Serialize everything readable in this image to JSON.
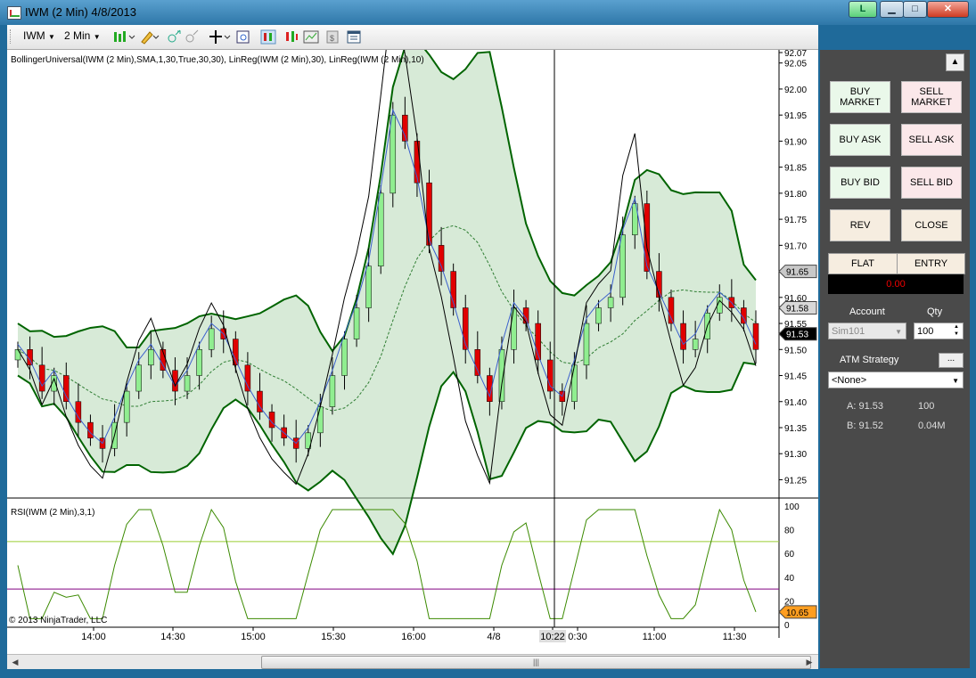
{
  "window": {
    "title": "IWM (2 Min)  4/8/2013",
    "btn_l": "L"
  },
  "toolbar": {
    "instrument": "IWM",
    "interval": "2 Min"
  },
  "chart": {
    "indicator_label": "BollingerUniversal(IWM (2 Min),SMA,1,30,True,30,30), LinReg(IWM (2 Min),30), LinReg(IWM (2 Min),10)",
    "rsi_label": "RSI(IWM (2 Min),3,1)",
    "copyright": "© 2013 NinjaTrader, LLC",
    "price_ticks": [
      "92.07",
      "92.05",
      "92.00",
      "91.95",
      "91.90",
      "91.85",
      "91.80",
      "91.75",
      "91.70",
      "91.65",
      "91.60",
      "91.55",
      "91.50",
      "91.45",
      "91.40",
      "91.35",
      "91.30",
      "91.25"
    ],
    "rsi_ticks": [
      "100",
      "80",
      "60",
      "40",
      "20",
      "0"
    ],
    "time_ticks": [
      "14:00",
      "14:30",
      "15:00",
      "15:30",
      "16:00",
      "4/8",
      "10:22",
      "0:30",
      "11:00",
      "11:30"
    ],
    "price_flags": {
      "upper": "91.65",
      "mid": "91.58",
      "last": "91.53"
    },
    "rsi_flag": "10.65"
  },
  "chart_data": {
    "type": "candlestick",
    "instrument": "IWM",
    "interval": "2 Min",
    "ylim": [
      91.22,
      92.07
    ],
    "x_ticks": [
      "14:00",
      "14:30",
      "15:00",
      "15:30",
      "16:00",
      "4/8",
      "10:30",
      "11:00",
      "11:30"
    ],
    "last_price": 91.53,
    "rsi_last": 10.65,
    "rsi_levels": [
      70,
      30
    ],
    "close_approx": [
      91.5,
      91.47,
      91.42,
      91.45,
      91.4,
      91.36,
      91.33,
      91.31,
      91.36,
      91.42,
      91.47,
      91.5,
      91.46,
      91.42,
      91.45,
      91.5,
      91.54,
      91.52,
      91.47,
      91.42,
      91.38,
      91.35,
      91.33,
      91.31,
      91.34,
      91.39,
      91.45,
      91.52,
      91.58,
      91.66,
      91.8,
      91.95,
      91.9,
      91.82,
      91.7,
      91.65,
      91.58,
      91.5,
      91.45,
      91.4,
      91.5,
      91.58,
      91.55,
      91.48,
      91.42,
      91.4,
      91.47,
      91.55,
      91.58,
      91.6,
      91.72,
      91.78,
      91.65,
      91.6,
      91.55,
      91.5,
      91.52,
      91.57,
      91.6,
      91.58,
      91.55,
      91.5
    ]
  },
  "panel": {
    "buy_market": "BUY MARKET",
    "sell_market": "SELL MARKET",
    "buy_ask": "BUY ASK",
    "sell_ask": "SELL ASK",
    "buy_bid": "BUY BID",
    "sell_bid": "SELL BID",
    "rev": "REV",
    "close": "CLOSE",
    "flat": "FLAT",
    "entry": "ENTRY",
    "pnl": "0.00",
    "account_label": "Account",
    "qty_label": "Qty",
    "account_value": "Sim101",
    "qty_value": "100",
    "atm_label": "ATM Strategy",
    "atm_btn": "...",
    "atm_value": "<None>",
    "ask_label": "A: 91.53",
    "ask_size": "100",
    "bid_label": "B: 91.52",
    "bid_size": "0.04M"
  },
  "colors": {
    "up_candle": "#90ee90",
    "down_candle": "#e00000",
    "upper_band_up": "#006400",
    "upper_band_down": "#8b0000",
    "rsi_line": "#3b8a00"
  }
}
